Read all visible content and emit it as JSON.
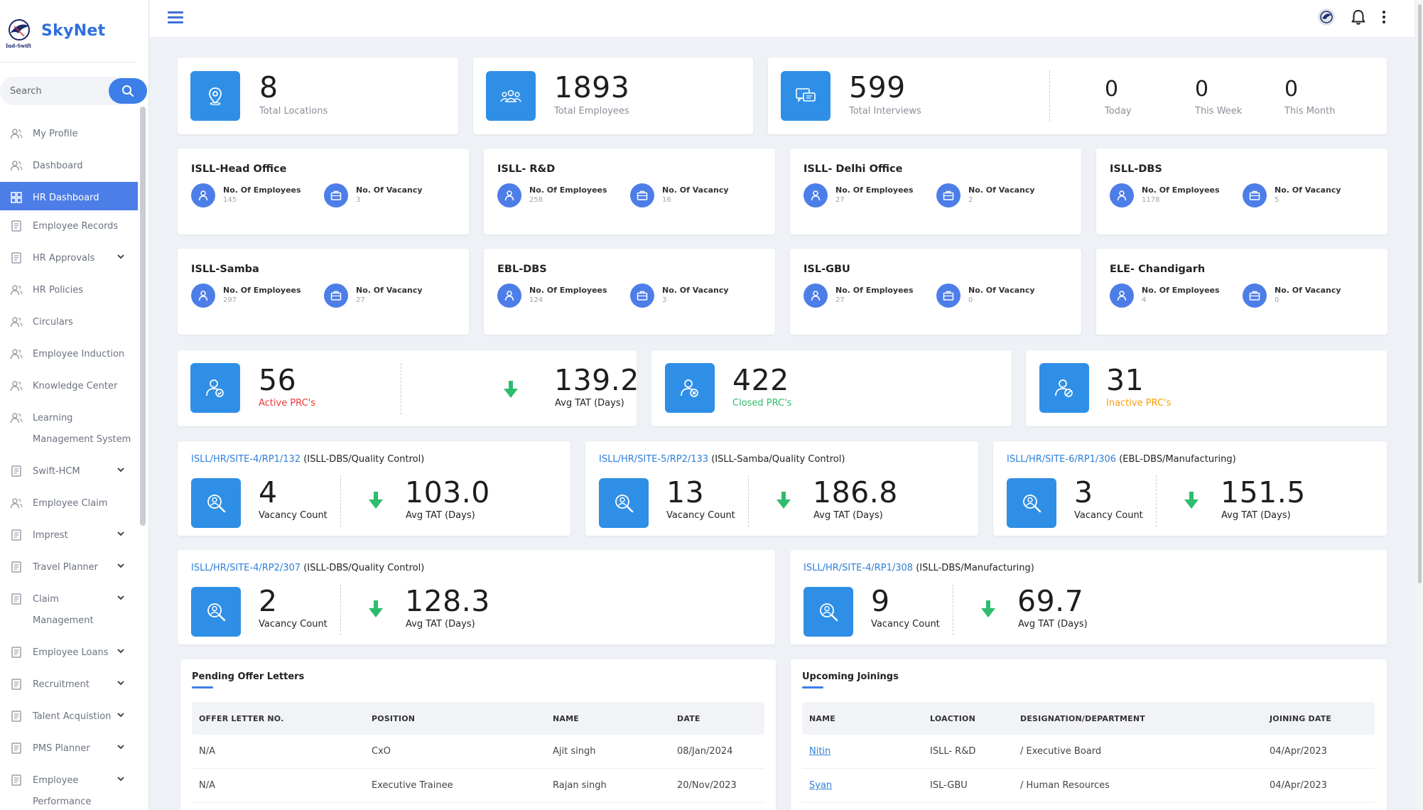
{
  "brand": {
    "name": "SkyNet",
    "logo_text": "Ind-Swift"
  },
  "search": {
    "placeholder": "Search"
  },
  "sidebar": {
    "items": [
      {
        "label": "My Profile"
      },
      {
        "label": "Dashboard"
      },
      {
        "label": "HR Dashboard"
      },
      {
        "label": "Employee Records"
      },
      {
        "label": "HR Approvals"
      },
      {
        "label": "HR Policies"
      },
      {
        "label": "Circulars"
      },
      {
        "label": "Employee Induction"
      },
      {
        "label": "Knowledge Center"
      },
      {
        "label": "Learning",
        "label2": "Management System"
      },
      {
        "label": "Swift-HCM"
      },
      {
        "label": "Employee Claim"
      },
      {
        "label": "Imprest"
      },
      {
        "label": "Travel Planner"
      },
      {
        "label": "Claim",
        "label2": "Management"
      },
      {
        "label": "Employee Loans"
      },
      {
        "label": "Recruitment"
      },
      {
        "label": "Talent Acquistion"
      },
      {
        "label": "PMS Planner"
      },
      {
        "label": "Employee",
        "label2": "Performance"
      }
    ]
  },
  "stats": {
    "locations": {
      "value": "8",
      "label": "Total Locations"
    },
    "employees": {
      "value": "1893",
      "label": "Total Employees"
    },
    "interviews": {
      "value": "599",
      "label": "Total Interviews"
    },
    "today": {
      "value": "0",
      "label": "Today"
    },
    "week": {
      "value": "0",
      "label": "This Week"
    },
    "month": {
      "value": "0",
      "label": "This Month"
    }
  },
  "location_labels": {
    "employees": "No. Of Employees",
    "vacancy": "No. Of Vacancy"
  },
  "locations": [
    {
      "name": "ISLL-Head Office",
      "employees": "145",
      "vacancy": "3"
    },
    {
      "name": "ISLL- R&D",
      "employees": "258",
      "vacancy": "16"
    },
    {
      "name": "ISLL- Delhi Office",
      "employees": "27",
      "vacancy": "2"
    },
    {
      "name": "ISLL-DBS",
      "employees": "1178",
      "vacancy": "5"
    },
    {
      "name": "ISLL-Samba",
      "employees": "297",
      "vacancy": "27"
    },
    {
      "name": "EBL-DBS",
      "employees": "124",
      "vacancy": "3"
    },
    {
      "name": "ISL-GBU",
      "employees": "27",
      "vacancy": "0"
    },
    {
      "name": "ELE- Chandigarh",
      "employees": "4",
      "vacancy": "0"
    }
  ],
  "prc": {
    "active": {
      "value": "56",
      "label": "Active PRC's"
    },
    "avg_tat": {
      "value": "139.2",
      "label": "Avg TAT (Days)"
    },
    "closed": {
      "value": "422",
      "label": "Closed PRC's"
    },
    "inactive": {
      "value": "31",
      "label": "Inactive PRC's"
    }
  },
  "vacancy_labels": {
    "count": "Vacancy Count",
    "tat": "Avg TAT (Days)"
  },
  "vacancies": [
    {
      "code": "ISLL/HR/SITE-4/RP1/132",
      "dept": "(ISLL-DBS/Quality Control)",
      "count": "4",
      "tat": "103.0"
    },
    {
      "code": "ISLL/HR/SITE-5/RP2/133",
      "dept": "(ISLL-Samba/Quality Control)",
      "count": "13",
      "tat": "186.8"
    },
    {
      "code": "ISLL/HR/SITE-6/RP1/306",
      "dept": "(EBL-DBS/Manufacturing)",
      "count": "3",
      "tat": "151.5"
    },
    {
      "code": "ISLL/HR/SITE-4/RP2/307",
      "dept": "(ISLL-DBS/Quality Control)",
      "count": "2",
      "tat": "128.3"
    },
    {
      "code": "ISLL/HR/SITE-4/RP1/308",
      "dept": "(ISLL-DBS/Manufacturing)",
      "count": "9",
      "tat": "69.7"
    }
  ],
  "offers": {
    "title": "Pending Offer Letters",
    "columns": [
      "OFFER LETTER NO.",
      "POSITION",
      "NAME",
      "DATE"
    ],
    "rows": [
      [
        "N/A",
        "CxO",
        "Ajit singh",
        "08/Jan/2024"
      ],
      [
        "N/A",
        "Executive Trainee",
        "Rajan singh",
        "20/Nov/2023"
      ]
    ]
  },
  "joinings": {
    "title": "Upcoming Joinings",
    "columns": [
      "NAME",
      "LOACTION",
      "DESIGNATION/DEPARTMENT",
      "JOINING DATE"
    ],
    "rows": [
      [
        "Nitin",
        "ISLL- R&D",
        "/ Executive Board",
        "04/Apr/2023"
      ],
      [
        "Syan",
        "ISL-GBU",
        "/ Human Resources",
        "04/Apr/2023"
      ]
    ]
  },
  "colors": {
    "accent": "#3d7fe8",
    "icon_box": "#2f8fe6",
    "active_red": "#e53935",
    "closed_green": "#2ebc6e",
    "inactive_orange": "#f59e0b",
    "link": "#2f7fd8"
  }
}
